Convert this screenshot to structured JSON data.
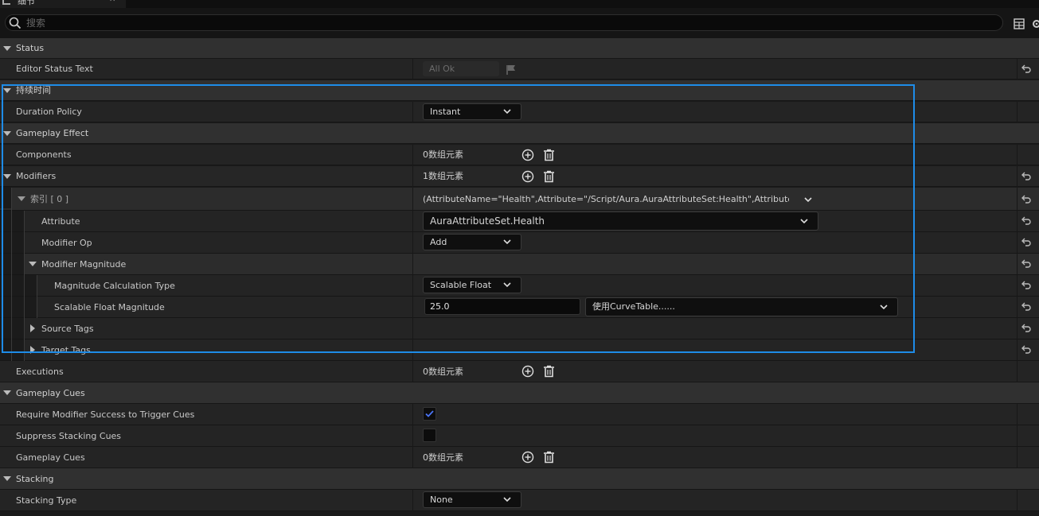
{
  "tab": {
    "title": "细节"
  },
  "search": {
    "placeholder": "搜索"
  },
  "rows": {
    "status_cat": "Status",
    "editor_status_text": "Editor Status Text",
    "editor_status_value": "All Ok",
    "duration_cat": "持续时间",
    "duration_policy": "Duration Policy",
    "duration_policy_value": "Instant",
    "ge_cat": "Gameplay Effect",
    "components": "Components",
    "components_value": "0数组元素",
    "modifiers": "Modifiers",
    "modifiers_value": "1数组元素",
    "index0": "索引 [ 0 ]",
    "index0_value": "(AttributeName=\"Health\",Attribute=\"/Script/Aura.AuraAttributeSet:Health\",AttributeOwner=N",
    "attribute": "Attribute",
    "attribute_value": "AuraAttributeSet.Health",
    "modifier_op": "Modifier Op",
    "modifier_op_value": "Add",
    "modifier_magnitude": "Modifier Magnitude",
    "magnitude_calc_type": "Magnitude Calculation Type",
    "magnitude_calc_type_value": "Scalable Float",
    "scalable_float_magnitude": "Scalable Float Magnitude",
    "scalable_float_value": "25.0",
    "curve_table_value": "使用CurveTable......",
    "source_tags": "Source Tags",
    "target_tags": "Target Tags",
    "executions": "Executions",
    "executions_value": "0数组元素",
    "cues_cat": "Gameplay Cues",
    "require_modifier_success": "Require Modifier Success to Trigger Cues",
    "require_modifier_success_checked": true,
    "suppress_stacking_cues": "Suppress Stacking Cues",
    "suppress_stacking_cues_checked": false,
    "gameplay_cues": "Gameplay Cues",
    "gameplay_cues_value": "0数组元素",
    "stacking_cat": "Stacking",
    "stacking_type": "Stacking Type",
    "stacking_type_value": "None"
  },
  "colors": {
    "highlight": "#1e8ce8",
    "check": "#3d6cf0"
  }
}
